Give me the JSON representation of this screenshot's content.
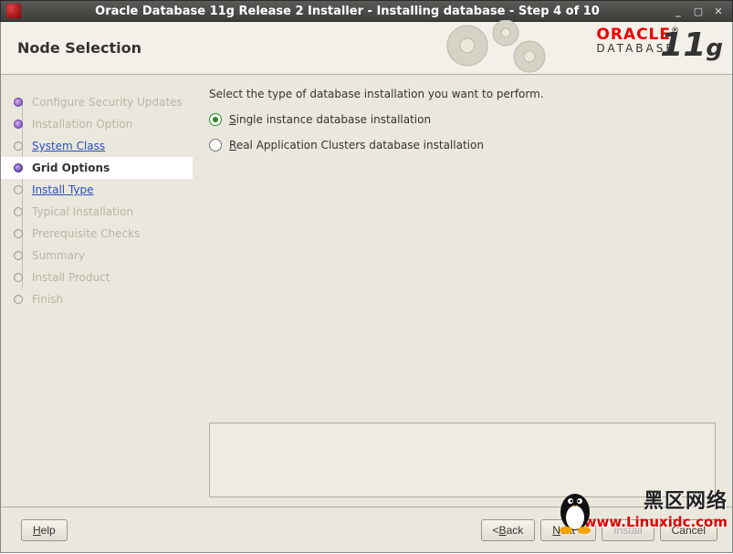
{
  "window": {
    "title": "Oracle Database 11g Release 2 Installer - Installing database - Step 4 of 10"
  },
  "header": {
    "page_title": "Node Selection",
    "brand_top": "ORACLE",
    "brand_bottom": "DATABASE",
    "version": "11",
    "version_suffix": "g"
  },
  "sidebar": {
    "steps": [
      {
        "label": "Configure Security Updates",
        "state": "done"
      },
      {
        "label": "Installation Option",
        "state": "done"
      },
      {
        "label": "System Class",
        "state": "link"
      },
      {
        "label": "Grid Options",
        "state": "current"
      },
      {
        "label": "Install Type",
        "state": "link"
      },
      {
        "label": "Typical Installation",
        "state": "pending"
      },
      {
        "label": "Prerequisite Checks",
        "state": "pending"
      },
      {
        "label": "Summary",
        "state": "pending"
      },
      {
        "label": "Install Product",
        "state": "pending"
      },
      {
        "label": "Finish",
        "state": "pending"
      }
    ]
  },
  "main": {
    "instruction": "Select the type of database installation you want to perform.",
    "options": [
      {
        "label_pre": "",
        "mnemonic": "S",
        "label_post": "ingle instance database installation",
        "checked": true
      },
      {
        "label_pre": "",
        "mnemonic": "R",
        "label_post": "eal Application Clusters database installation",
        "checked": false
      }
    ]
  },
  "footer": {
    "help": "Help",
    "back": "Back",
    "next": "Next",
    "install": "Install",
    "cancel": "Cancel"
  },
  "watermark": {
    "cn": "黑区网络",
    "url": "www.Linuxidc.com"
  }
}
